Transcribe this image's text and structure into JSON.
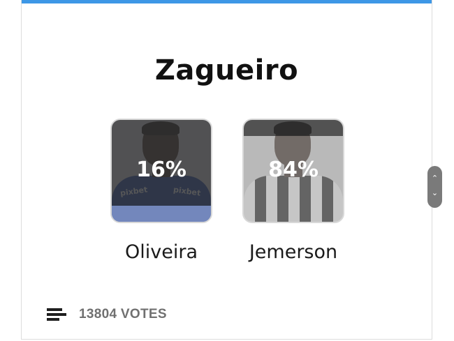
{
  "poll": {
    "title": "Zagueiro",
    "options": [
      {
        "name": "Oliveira",
        "percent_label": "16%",
        "percent": 16,
        "photo": "player-photo-blue-jersey",
        "sponsor": "pixbet"
      },
      {
        "name": "Jemerson",
        "percent_label": "84%",
        "percent": 84,
        "photo": "player-photo-striped-jersey"
      }
    ],
    "votes_label": "13804 VOTES",
    "votes_icon": "bar-chart-icon"
  },
  "scroll_widget": {
    "up_icon": "chevron-up-icon",
    "down_icon": "chevron-down-icon"
  },
  "colors": {
    "accent_bar": "#3d97e6",
    "title": "#111111",
    "votes_text": "#707070"
  }
}
